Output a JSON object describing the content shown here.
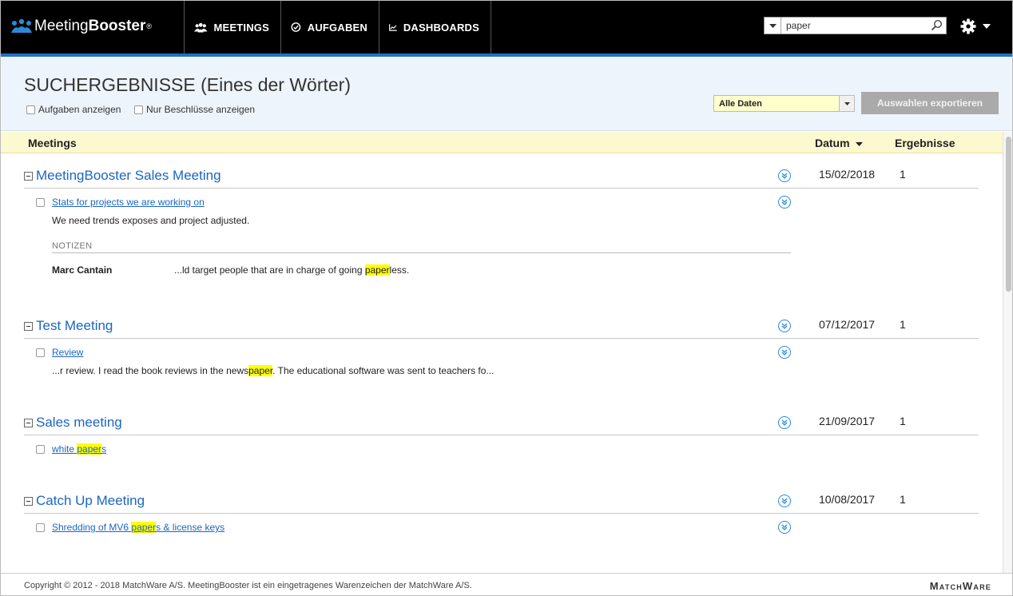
{
  "app": {
    "logo_regular": "Meeting",
    "logo_bold": "Booster",
    "logo_mark": "®"
  },
  "nav": {
    "meetings": "MEETINGS",
    "tasks": "AUFGABEN",
    "dashboards": "DASHBOARDS"
  },
  "search": {
    "value": "paper"
  },
  "header": {
    "title": "SUCHERGEBNISSE (Eines der Wörter)",
    "show_tasks": "Aufgaben anzeigen",
    "only_decisions": "Nur Beschlüsse anzeigen",
    "date_filter": "Alle Daten",
    "export_button": "Auswahlen exportieren"
  },
  "columns": {
    "meetings": "Meetings",
    "date": "Datum",
    "results": "Ergebnisse"
  },
  "meetings": [
    {
      "title": "MeetingBooster Sales Meeting",
      "date": "15/02/2018",
      "count": "1",
      "item_link": "Stats for projects we are working on",
      "item_text": "We need trends exposes and project adjusted.",
      "notes_label": "NOTIZEN",
      "note_author": "Marc Cantain",
      "note_pre": "...ld target people that are in charge of going ",
      "note_hl": "paper",
      "note_post": "less."
    },
    {
      "title": "Test Meeting",
      "date": "07/12/2017",
      "count": "1",
      "item_link": "Review",
      "snippet_pre": "...r review. I read the book reviews in the news",
      "snippet_hl": "paper",
      "snippet_post": ". The educational software was sent to teachers fo..."
    },
    {
      "title": "Sales meeting",
      "date": "21/09/2017",
      "count": "1",
      "link_pre": "white ",
      "link_hl": "paper",
      "link_post": "s"
    },
    {
      "title": "Catch Up Meeting",
      "date": "10/08/2017",
      "count": "1",
      "link_pre": "Shredding of MV6 ",
      "link_hl": "paper",
      "link_post": "s & license keys"
    }
  ],
  "footer": {
    "copyright": "Copyright © 2012 - 2018 MatchWare A/S. MeetingBooster ist ein eingetragenes Warenzeichen der MatchWare A/S.",
    "brand": "MatchWare"
  },
  "colors": {
    "accent": "#1e73c8",
    "link": "#1a66c2",
    "highlight": "#ffff00",
    "column_header_bg": "#fcf8d0",
    "header_bg": "#eef4fc"
  }
}
